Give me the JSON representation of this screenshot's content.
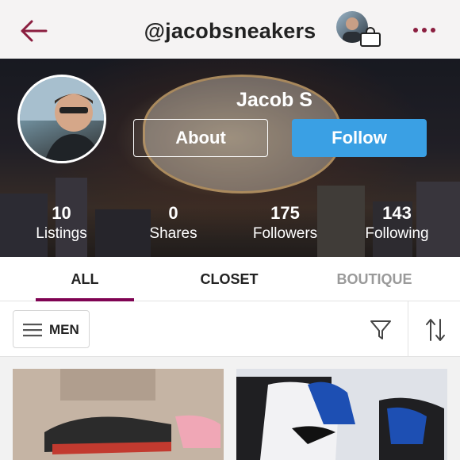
{
  "header": {
    "handle": "@jacobsneakers",
    "back_icon": "back-arrow-icon",
    "more_icon": "more-dots-icon",
    "accent": "#8b1e3f"
  },
  "profile": {
    "name": "Jacob S",
    "about_label": "About",
    "follow_label": "Follow",
    "stats": [
      {
        "value": "10",
        "label": "Listings"
      },
      {
        "value": "0",
        "label": "Shares"
      },
      {
        "value": "175",
        "label": "Followers"
      },
      {
        "value": "143",
        "label": "Following"
      }
    ]
  },
  "tabs": [
    {
      "label": "ALL",
      "active": true
    },
    {
      "label": "CLOSET",
      "active": false
    },
    {
      "label": "BOUTIQUE",
      "active": false
    }
  ],
  "filters": {
    "department": "MEN",
    "filter_icon": "filter-funnel-icon",
    "sort_icon": "sort-arrows-icon"
  },
  "colors": {
    "follow": "#3aa0e4",
    "tab_underline": "#7f0353",
    "inactive_tab": "#9a9a9a"
  }
}
